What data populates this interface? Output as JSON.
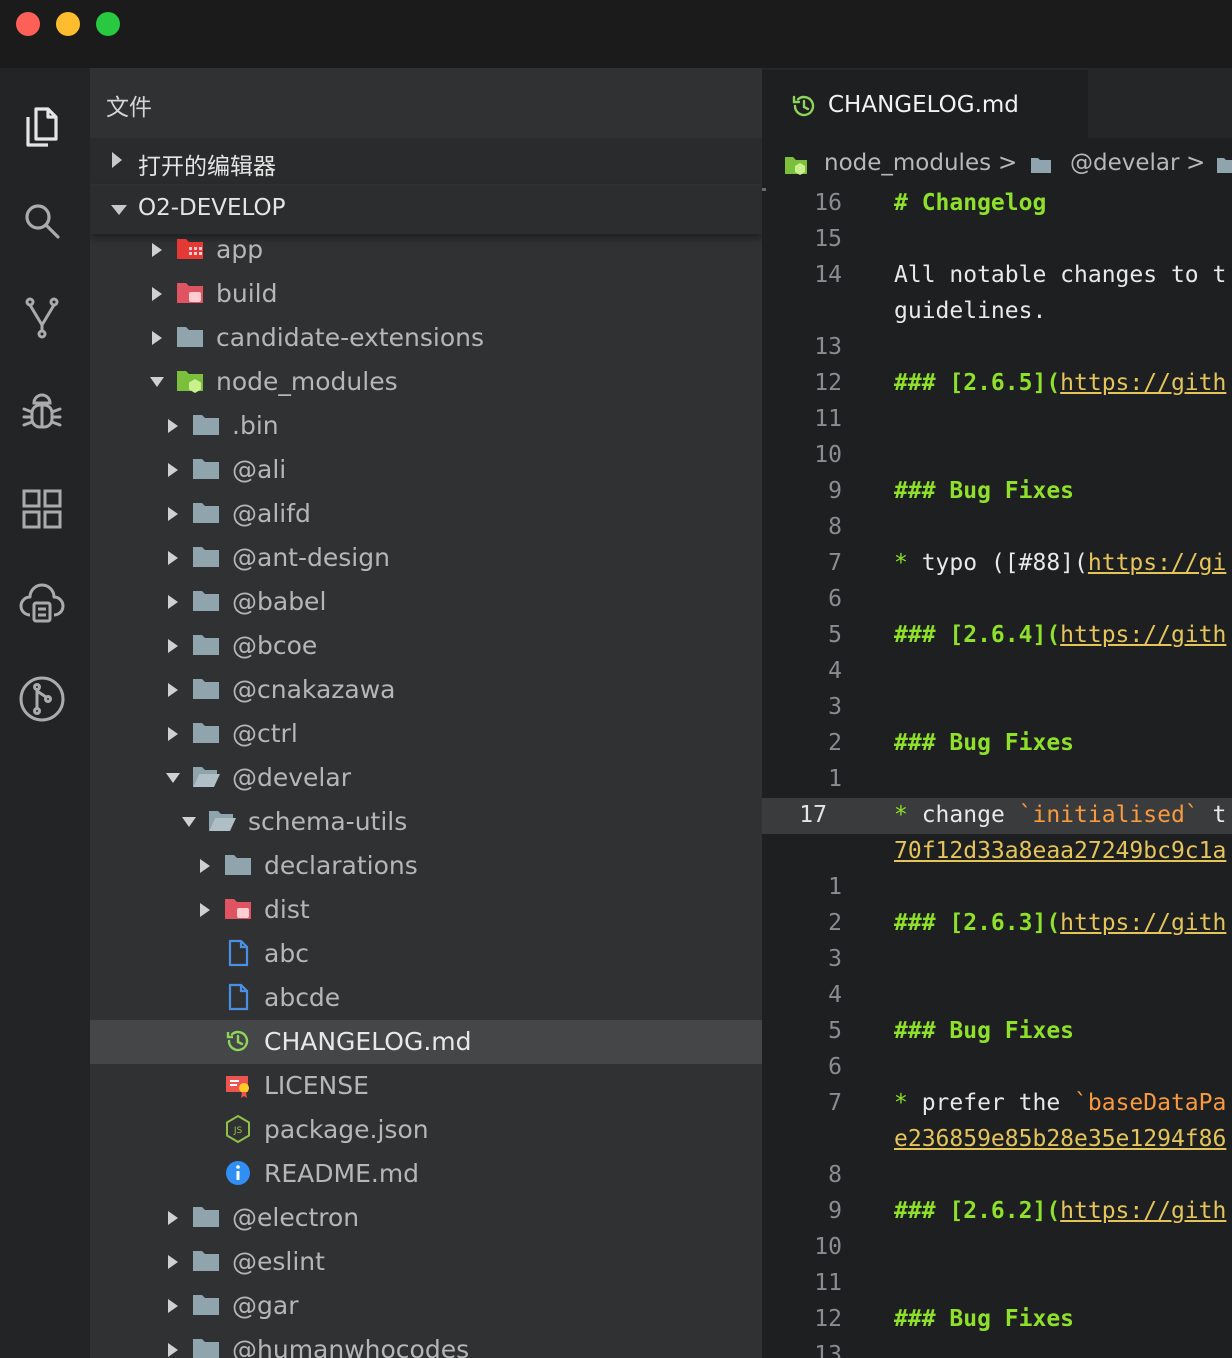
{
  "window": {
    "traffic_lights": [
      "close",
      "minimize",
      "maximize"
    ],
    "colors": {
      "close": "#fe5f57",
      "minimize": "#febc2e",
      "maximize": "#28c840"
    }
  },
  "activity_bar": {
    "items": [
      {
        "icon": "files-icon"
      },
      {
        "icon": "search-icon"
      },
      {
        "icon": "source-control-icon"
      },
      {
        "icon": "debug-icon"
      },
      {
        "icon": "extensions-icon"
      },
      {
        "icon": "remote-explorer-icon"
      },
      {
        "icon": "git-graph-icon"
      }
    ]
  },
  "sidebar": {
    "title": "文件",
    "sections": {
      "open_editors": "打开的编辑器",
      "project": "O2-DEVELOP"
    },
    "tree": [
      {
        "name": "app",
        "depth": 0,
        "kind": "folder-red-grid",
        "expanded": false
      },
      {
        "name": "build",
        "depth": 0,
        "kind": "folder-red",
        "expanded": false
      },
      {
        "name": "candidate-extensions",
        "depth": 0,
        "kind": "folder",
        "expanded": false
      },
      {
        "name": "node_modules",
        "depth": 0,
        "kind": "folder-node",
        "expanded": true
      },
      {
        "name": ".bin",
        "depth": 1,
        "kind": "folder",
        "expanded": false
      },
      {
        "name": "@ali",
        "depth": 1,
        "kind": "folder",
        "expanded": false
      },
      {
        "name": "@alifd",
        "depth": 1,
        "kind": "folder",
        "expanded": false
      },
      {
        "name": "@ant-design",
        "depth": 1,
        "kind": "folder",
        "expanded": false
      },
      {
        "name": "@babel",
        "depth": 1,
        "kind": "folder",
        "expanded": false
      },
      {
        "name": "@bcoe",
        "depth": 1,
        "kind": "folder",
        "expanded": false
      },
      {
        "name": "@cnakazawa",
        "depth": 1,
        "kind": "folder",
        "expanded": false
      },
      {
        "name": "@ctrl",
        "depth": 1,
        "kind": "folder",
        "expanded": false
      },
      {
        "name": "@develar",
        "depth": 1,
        "kind": "folder-open",
        "expanded": true
      },
      {
        "name": "schema-utils",
        "depth": 2,
        "kind": "folder-open",
        "expanded": true
      },
      {
        "name": "declarations",
        "depth": 3,
        "kind": "folder",
        "expanded": false
      },
      {
        "name": "dist",
        "depth": 3,
        "kind": "folder-red",
        "expanded": false
      },
      {
        "name": "abc",
        "depth": 3,
        "kind": "file-doc"
      },
      {
        "name": "abcde",
        "depth": 3,
        "kind": "file-doc"
      },
      {
        "name": "CHANGELOG.md",
        "depth": 3,
        "kind": "file-changelog",
        "selected": true
      },
      {
        "name": "LICENSE",
        "depth": 3,
        "kind": "file-license"
      },
      {
        "name": "package.json",
        "depth": 3,
        "kind": "file-js"
      },
      {
        "name": "README.md",
        "depth": 3,
        "kind": "file-info"
      },
      {
        "name": "@electron",
        "depth": 1,
        "kind": "folder",
        "expanded": false
      },
      {
        "name": "@eslint",
        "depth": 1,
        "kind": "folder",
        "expanded": false
      },
      {
        "name": "@gar",
        "depth": 1,
        "kind": "folder",
        "expanded": false
      },
      {
        "name": "@humanwhocodes",
        "depth": 1,
        "kind": "folder",
        "expanded": false
      }
    ]
  },
  "editor": {
    "tab": {
      "label": "CHANGELOG.md",
      "icon": "history-icon"
    },
    "breadcrumb": [
      "node_modules",
      "@develar"
    ],
    "breadcrumb_separator": ">",
    "lines": [
      {
        "num": "16",
        "segments": [
          {
            "t": "# Changelog",
            "c": "h"
          }
        ]
      },
      {
        "num": "15",
        "segments": []
      },
      {
        "num": "14",
        "segments": [
          {
            "t": "All notable changes to t",
            "c": ""
          }
        ]
      },
      {
        "num": "",
        "segments": [
          {
            "t": "guidelines.",
            "c": ""
          }
        ]
      },
      {
        "num": "13",
        "segments": []
      },
      {
        "num": "12",
        "segments": [
          {
            "t": "### [2.6.5](",
            "c": "h"
          },
          {
            "t": "https://gith",
            "c": "u"
          }
        ]
      },
      {
        "num": "11",
        "segments": []
      },
      {
        "num": "10",
        "segments": []
      },
      {
        "num": "9",
        "segments": [
          {
            "t": "### Bug Fixes",
            "c": "h"
          }
        ]
      },
      {
        "num": "8",
        "segments": []
      },
      {
        "num": "7",
        "segments": [
          {
            "t": "* ",
            "c": "star"
          },
          {
            "t": "typo ([#88](",
            "c": ""
          },
          {
            "t": "https://gi",
            "c": "u"
          }
        ]
      },
      {
        "num": "6",
        "segments": []
      },
      {
        "num": "5",
        "segments": [
          {
            "t": "### [2.6.4](",
            "c": "h"
          },
          {
            "t": "https://gith",
            "c": "u"
          }
        ]
      },
      {
        "num": "4",
        "segments": []
      },
      {
        "num": "3",
        "segments": []
      },
      {
        "num": "2",
        "segments": [
          {
            "t": "### Bug Fixes",
            "c": "h"
          }
        ]
      },
      {
        "num": "1",
        "segments": []
      },
      {
        "num": "17",
        "current": true,
        "segments": [
          {
            "t": "* ",
            "c": "star"
          },
          {
            "t": "change ",
            "c": ""
          },
          {
            "t": "`initialised`",
            "c": "bq"
          },
          {
            "t": " t",
            "c": ""
          }
        ]
      },
      {
        "num": "",
        "segments": [
          {
            "t": "70f12d33a8eaa27249bc9c1a",
            "c": "u"
          }
        ]
      },
      {
        "num": "1",
        "segments": []
      },
      {
        "num": "2",
        "segments": [
          {
            "t": "### [2.6.3](",
            "c": "h"
          },
          {
            "t": "https://gith",
            "c": "u"
          }
        ]
      },
      {
        "num": "3",
        "segments": []
      },
      {
        "num": "4",
        "segments": []
      },
      {
        "num": "5",
        "segments": [
          {
            "t": "### Bug Fixes",
            "c": "h"
          }
        ]
      },
      {
        "num": "6",
        "segments": []
      },
      {
        "num": "7",
        "segments": [
          {
            "t": "* ",
            "c": "star"
          },
          {
            "t": "prefer the ",
            "c": ""
          },
          {
            "t": "`baseDataPa",
            "c": "bq"
          }
        ]
      },
      {
        "num": "",
        "segments": [
          {
            "t": "e236859e85b28e35e1294f86",
            "c": "u"
          }
        ]
      },
      {
        "num": "8",
        "segments": []
      },
      {
        "num": "9",
        "segments": [
          {
            "t": "### [2.6.2](",
            "c": "h"
          },
          {
            "t": "https://gith",
            "c": "u"
          }
        ]
      },
      {
        "num": "10",
        "segments": []
      },
      {
        "num": "11",
        "segments": []
      },
      {
        "num": "12",
        "segments": [
          {
            "t": "### Bug Fixes",
            "c": "h"
          }
        ]
      },
      {
        "num": "13",
        "segments": []
      }
    ]
  }
}
